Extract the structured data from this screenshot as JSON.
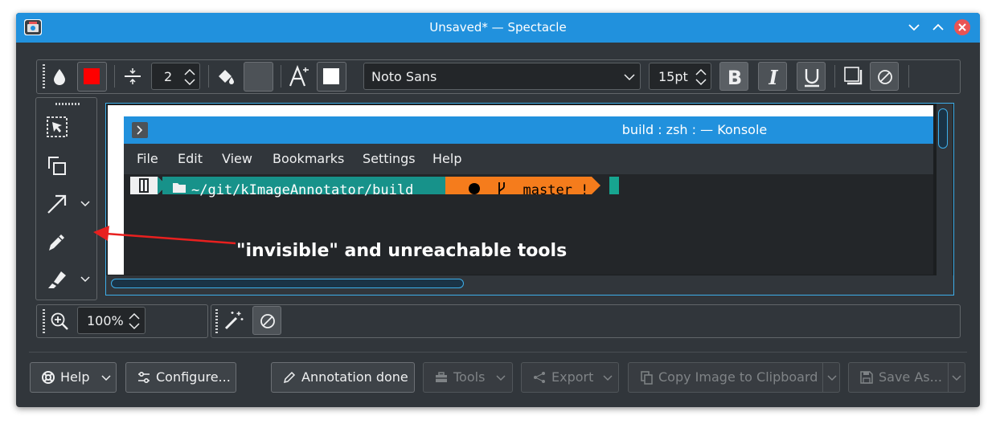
{
  "window": {
    "title": "Unsaved* — Spectacle"
  },
  "toolbar": {
    "stroke_width": "2",
    "font_family": "Noto Sans",
    "font_size": "15pt",
    "colors": {
      "stroke": "#ff0000",
      "fill": "#4d5257",
      "text": "#ffffff"
    }
  },
  "side_tools": [
    {
      "name": "select-tool",
      "icon": "select-icon"
    },
    {
      "name": "duplicate-tool",
      "icon": "duplicate-icon"
    },
    {
      "name": "arrow-tool",
      "icon": "arrow-icon"
    },
    {
      "name": "pen-tool",
      "icon": "pencil-icon"
    },
    {
      "name": "marker-tool",
      "icon": "marker-icon"
    }
  ],
  "zoom": {
    "value": "100%"
  },
  "konsole": {
    "title": "build : zsh : — Konsole",
    "menu": [
      "File",
      "Edit",
      "View",
      "Bookmarks",
      "Settings",
      "Help"
    ],
    "prompt_path": "~/git/kImageAnnotator/build",
    "prompt_branch": "master !"
  },
  "annotation": {
    "text": "\"invisible\" and unreachable tools"
  },
  "dialog_buttons": {
    "help": "Help",
    "configure": "Configure...",
    "annotation_done": "Annotation done",
    "tools": "Tools",
    "export": "Export",
    "copy": "Copy Image to Clipboard",
    "save_as": "Save As..."
  },
  "colors": {
    "accent": "#2191dd",
    "highlight": "#3daee9",
    "annotation": "#e8201f"
  }
}
